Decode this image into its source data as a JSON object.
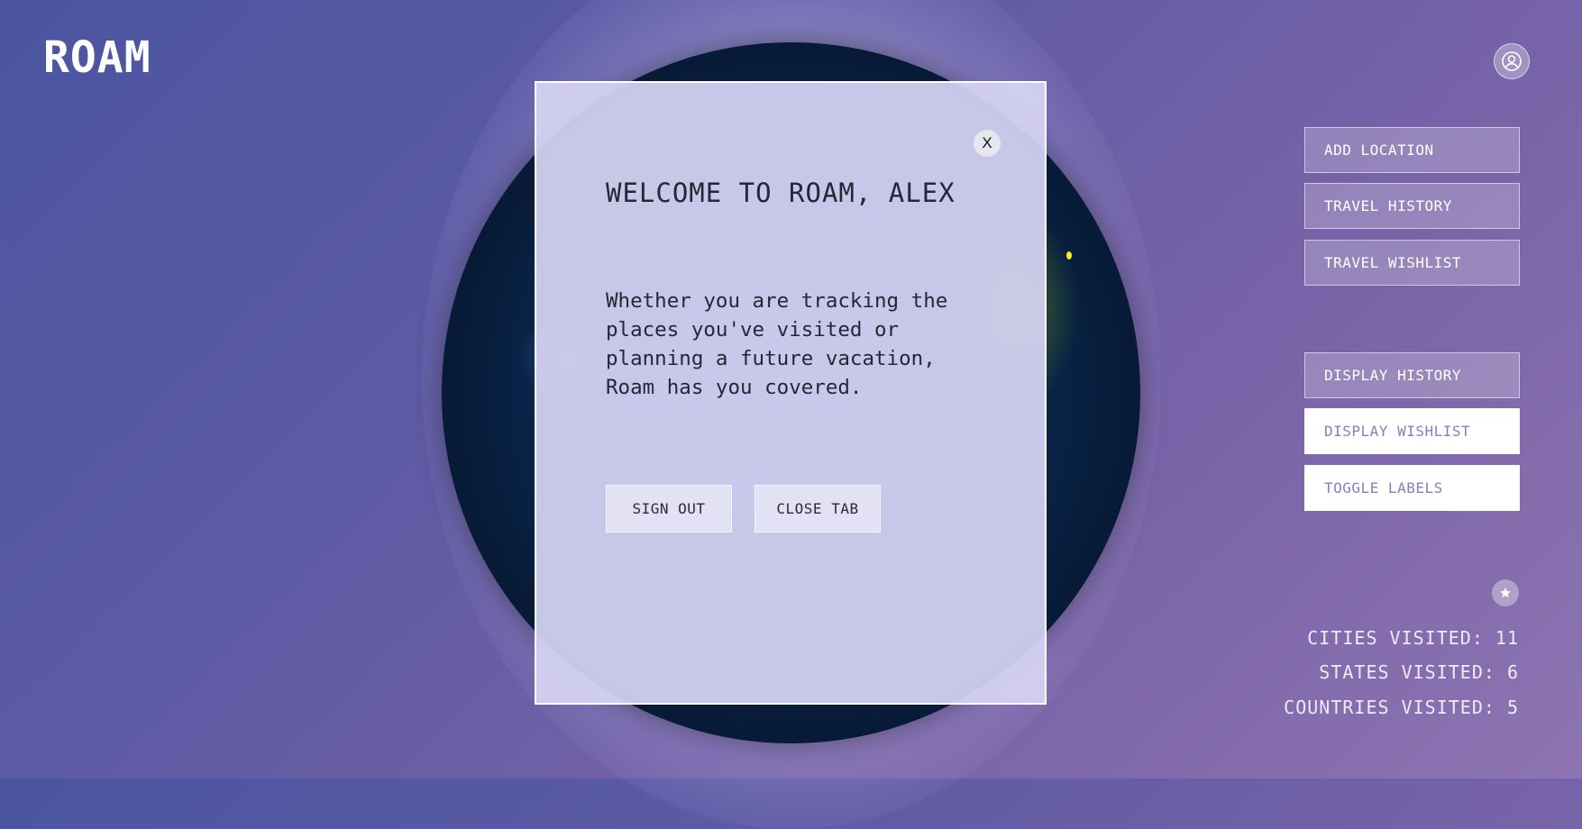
{
  "app": {
    "logo": "ROAM"
  },
  "header": {
    "profile_icon": "user-circle-icon"
  },
  "sidebar": {
    "actions": [
      {
        "label": "ADD LOCATION"
      },
      {
        "label": "TRAVEL HISTORY"
      },
      {
        "label": "TRAVEL WISHLIST"
      }
    ],
    "display": [
      {
        "label": "DISPLAY HISTORY",
        "active": false
      },
      {
        "label": "DISPLAY WISHLIST",
        "active": true
      },
      {
        "label": "TOGGLE LABELS",
        "active": true
      }
    ],
    "star_icon": "star-icon"
  },
  "stats": {
    "cities": "CITIES VISITED: 11",
    "states": "STATES VISITED: 6",
    "countries": "COUNTRIES VISITED: 5"
  },
  "modal": {
    "close_label": "X",
    "title": "WELCOME TO ROAM, ALEX",
    "body": "Whether you are tracking the places you've visited or planning a future vacation, Roam has you covered.",
    "sign_out_label": "SIGN OUT",
    "close_tab_label": "CLOSE TAB"
  },
  "colors": {
    "background": "#5d5aa4",
    "active_button_text": "#8a7cc0",
    "marker": "#f6f21a"
  }
}
